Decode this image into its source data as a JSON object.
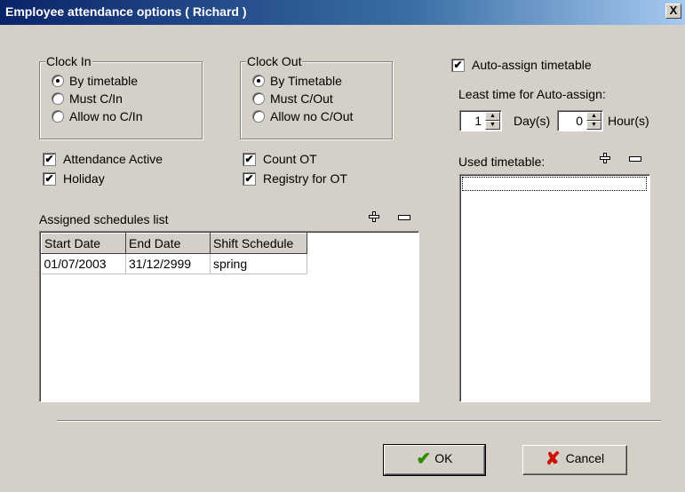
{
  "window": {
    "title": "Employee attendance options ( Richard )",
    "close_label": "X"
  },
  "clock_in": {
    "legend": "Clock In",
    "options": [
      "By timetable",
      "Must C/In",
      "Allow no C/In"
    ],
    "selected": 0
  },
  "clock_out": {
    "legend": "Clock Out",
    "options": [
      "By Timetable",
      "Must C/Out",
      "Allow no C/Out"
    ],
    "selected": 0
  },
  "checks": {
    "attendance_active": {
      "label": "Attendance Active",
      "checked": true
    },
    "holiday": {
      "label": "Holiday",
      "checked": true
    },
    "count_ot": {
      "label": "Count OT",
      "checked": true
    },
    "registry_ot": {
      "label": "Registry for OT",
      "checked": true
    },
    "auto_assign": {
      "label": "Auto-assign timetable",
      "checked": true
    }
  },
  "check_mark": "✔",
  "auto_assign": {
    "least_time_label": "Least time for Auto-assign:",
    "days_value": "1",
    "days_unit": "Day(s)",
    "hours_value": "0",
    "hours_unit": "Hour(s)"
  },
  "used_timetable": {
    "label": "Used timetable:"
  },
  "schedules": {
    "label": "Assigned schedules list",
    "columns": [
      "Start Date",
      "End Date",
      "Shift Schedule"
    ],
    "rows": [
      [
        "01/07/2003",
        "31/12/2999",
        "spring"
      ]
    ]
  },
  "buttons": {
    "ok_label": "OK",
    "ok_icon": "✔",
    "cancel_label": "Cancel",
    "cancel_icon": "✘"
  },
  "colors": {
    "titlebar_start": "#0a246a",
    "titlebar_end": "#a6caf0",
    "dialog_bg": "#d4d0c8",
    "ok_icon": "#2e8b00",
    "cancel_icon": "#cc1100"
  },
  "spinner": {
    "up": "▲",
    "down": "▼"
  }
}
